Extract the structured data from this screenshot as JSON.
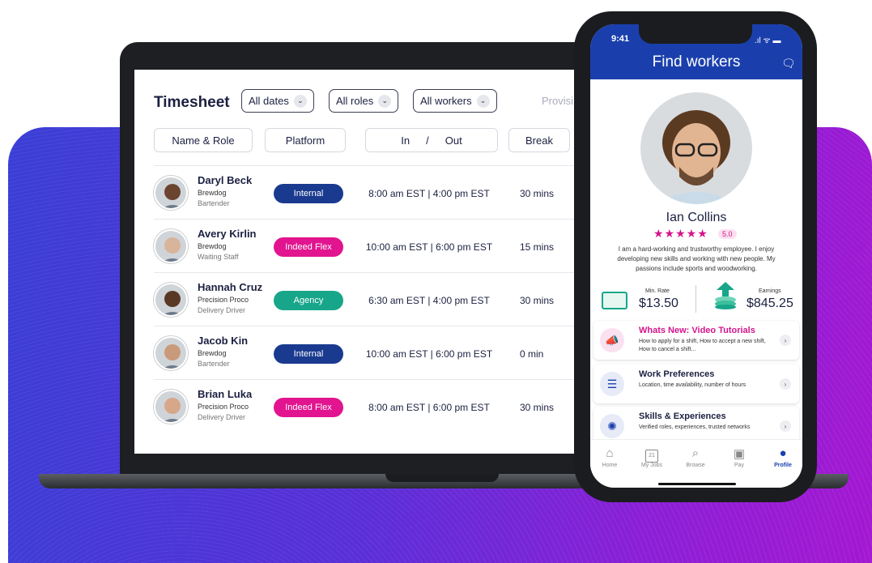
{
  "timesheet": {
    "title": "Timesheet",
    "filters": [
      "All dates",
      "All roles",
      "All workers"
    ],
    "cutoff_label": "Provisi",
    "columns": [
      "Name & Role",
      "Platform",
      "In",
      "/",
      "Out",
      "Break"
    ],
    "rows": [
      {
        "name": "Daryl Beck",
        "company": "Brewdog",
        "role": "Bartender",
        "platform": "Internal",
        "platform_color": "#1a3a8f",
        "time": "8:00 am EST | 4:00 pm EST",
        "break": "30 mins"
      },
      {
        "name": "Avery Kirlin",
        "company": "Brewdog",
        "role": "Waiting Staff",
        "platform": "Indeed Flex",
        "platform_color": "#e2148f",
        "time": "10:00 am EST | 6:00 pm EST",
        "break": "15 mins"
      },
      {
        "name": "Hannah Cruz",
        "company": "Precision Proco",
        "role": "Delivery Driver",
        "platform": "Agency",
        "platform_color": "#17a68a",
        "time": "6:30 am EST | 4:00 pm EST",
        "break": "30 mins"
      },
      {
        "name": "Jacob Kin",
        "company": "Brewdog",
        "role": "Bartender",
        "platform": "Internal",
        "platform_color": "#1a3a8f",
        "time": "10:00 am EST | 6:00 pm EST",
        "break": "0 min"
      },
      {
        "name": "Brian Luka",
        "company": "Precision Proco",
        "role": "Delivery Driver",
        "platform": "Indeed Flex",
        "platform_color": "#e2148f",
        "time": "8:00 am EST | 6:00 pm EST",
        "break": "30 mins"
      }
    ]
  },
  "phone": {
    "time": "9:41",
    "status_icons": ".ıl ᯤ ▬",
    "title": "Find workers",
    "header_color": "#1a3fad",
    "profile": {
      "name": "Ian Collins",
      "stars": "★★★★★",
      "rating": "5.0",
      "bio": "I am a hard-working and trustworthy employee. I enjoy developing new skills and working with new people. My passions include sports and woodworking.",
      "min_rate_label": "Min. Rate",
      "min_rate": "$13.50",
      "earnings_label": "Earnings",
      "earnings": "$845.25"
    },
    "cards": [
      {
        "title": "Whats New: Video Tutorials",
        "subtitle": "How to apply for a shift, How to accept a new shift, How to cancel a shift...",
        "icon": "megaphone-icon",
        "title_color": "#d4148c"
      },
      {
        "title": "Work Preferences",
        "subtitle": "Location, time availability, number of hours",
        "icon": "sliders-icon",
        "title_color": "#1b2040"
      },
      {
        "title": "Skills & Experiences",
        "subtitle": "Verified roles, experiences, trusted networks",
        "icon": "lightbulb-icon",
        "title_color": "#1b2040"
      }
    ],
    "tabs": [
      {
        "label": "Home",
        "icon": "home-icon"
      },
      {
        "label": "My Jobs",
        "icon": "calendar-icon",
        "day": "21"
      },
      {
        "label": "Browse",
        "icon": "search-icon"
      },
      {
        "label": "Pay",
        "icon": "pay-icon"
      },
      {
        "label": "Profile",
        "icon": "profile-icon",
        "active": true
      }
    ]
  }
}
